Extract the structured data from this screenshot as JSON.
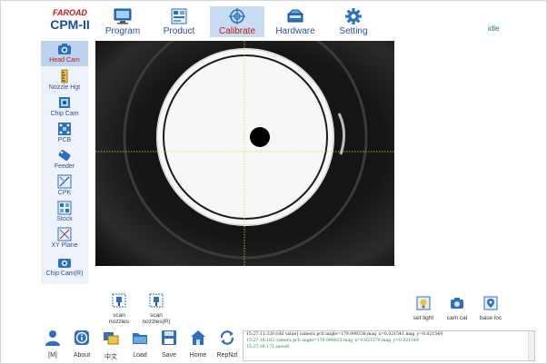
{
  "app": {
    "brand": "FAROAD",
    "model": "CPM-II",
    "status": "idle"
  },
  "tabs": [
    {
      "label": "Program",
      "icon": "monitor-icon"
    },
    {
      "label": "Product",
      "icon": "board-icon"
    },
    {
      "label": "Calibrate",
      "icon": "crosshair-icon",
      "active": true
    },
    {
      "label": "Hardware",
      "icon": "machine-icon"
    },
    {
      "label": "Setting",
      "icon": "gear-icon"
    }
  ],
  "sidebar": {
    "items": [
      {
        "label": "Head Cam",
        "icon": "camera-icon",
        "active": true
      },
      {
        "label": "Nozzle Hgt",
        "icon": "ruler-icon"
      },
      {
        "label": "Chip Cam",
        "icon": "chip-camera-icon"
      },
      {
        "label": "PCB",
        "icon": "pcb-icon"
      },
      {
        "label": "Feeder",
        "icon": "feeder-icon"
      },
      {
        "label": "CPK",
        "icon": "cpk-icon"
      },
      {
        "label": "Stock",
        "icon": "stock-icon"
      },
      {
        "label": "XY Plane",
        "icon": "xy-plane-icon"
      },
      {
        "label": "Chip Cam(R)",
        "icon": "chip-camera-r-icon"
      }
    ]
  },
  "scan_tools": [
    {
      "label1": "scan",
      "label2": "nozzles",
      "icon": "scan-nozzles-icon"
    },
    {
      "label1": "scan",
      "label2": "nozzles(R)",
      "icon": "scan-nozzles-r-icon"
    }
  ],
  "right_tools": [
    {
      "label": "set light",
      "icon": "light-bulb-icon"
    },
    {
      "label": "cam cal",
      "icon": "camera-cal-icon"
    },
    {
      "label": "base loc",
      "icon": "location-pin-icon"
    }
  ],
  "bottom_bar": [
    {
      "label": "[M]",
      "icon": "user-icon"
    },
    {
      "label": "About",
      "icon": "info-icon"
    },
    {
      "label": "中文",
      "icon": "language-icon"
    },
    {
      "label": "Load",
      "icon": "folder-icon"
    },
    {
      "label": "Save",
      "icon": "save-icon"
    },
    {
      "label": "Home",
      "icon": "home-icon"
    },
    {
      "label": "RepNzl",
      "icon": "repeat-icon"
    }
  ],
  "log": [
    {
      "text": "15:27:11:320 [old value] camera pcb angle=179.999336,mag_x=0.021541,mag_y=0.021549",
      "color": "#222222"
    },
    {
      "text": "15:27:16:163 camera pcb angle=179.998023,mag_x=0.021570,mag_y=0.021549",
      "color": "#1a8a3a"
    },
    {
      "text": "15:27:16:171 saved!",
      "color": "#1a8a3a"
    }
  ],
  "colors": {
    "accent": "#2a4f9b",
    "active_tab_bg": "#c8dcf2",
    "active_label": "#c01818",
    "status": "#1a8a3a"
  }
}
